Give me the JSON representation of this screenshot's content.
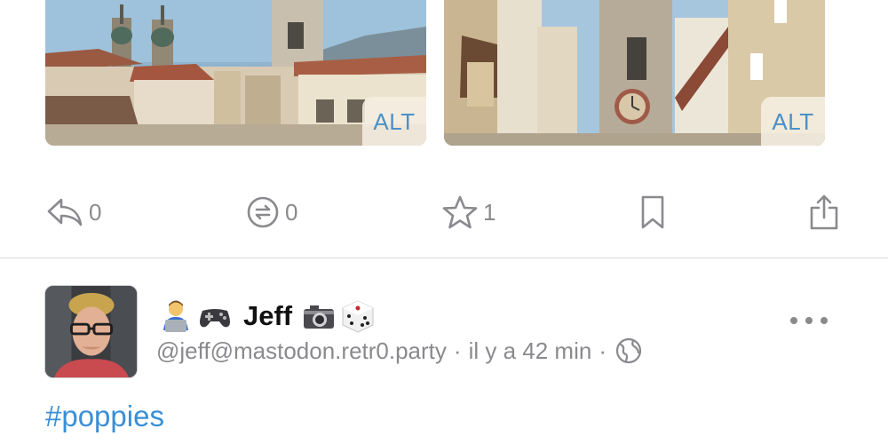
{
  "media": [
    {
      "alt_label": "ALT",
      "description": "photo-brixen-towers"
    },
    {
      "alt_label": "ALT",
      "description": "photo-clock-tower-street"
    }
  ],
  "actions": {
    "reply_count": "0",
    "boost_count": "0",
    "favourite_count": "1",
    "icons": [
      "reply-icon",
      "boost-icon",
      "star-icon",
      "bookmark-icon",
      "share-icon"
    ]
  },
  "post": {
    "display_name": "Jeff",
    "name_emojis": [
      "technologist-emoji",
      "game-controller-emoji",
      "camera-emoji",
      "die-emoji"
    ],
    "handle": "@jeff@mastodon.retr0.party",
    "separator": "·",
    "time_ago": "il y a 42 min",
    "visibility_icon": "globe-icon",
    "hashtag": "#poppies"
  },
  "colors": {
    "link": "#3a8fd6",
    "secondary_text": "#8a8a8e",
    "alt_badge_text": "#4a90c8",
    "divider": "#d9d9dc"
  }
}
